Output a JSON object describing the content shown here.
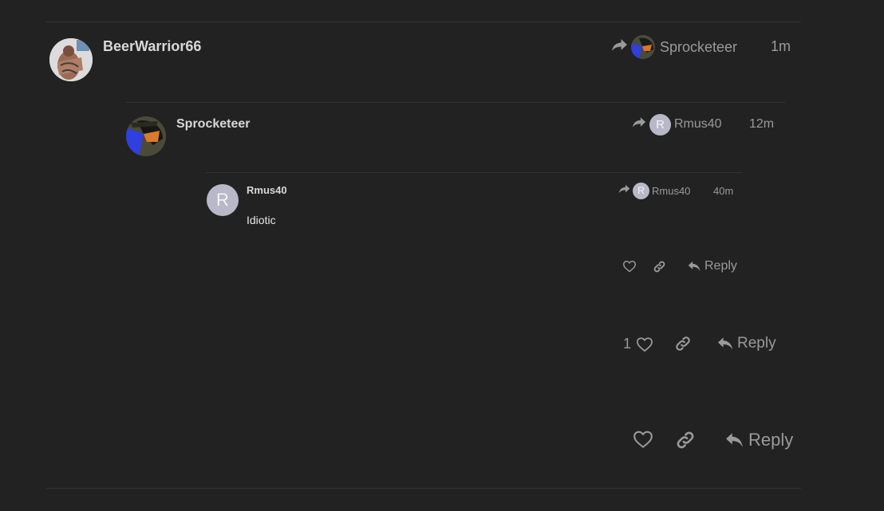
{
  "posts": [
    {
      "username": "BeerWarrior66",
      "reply_to": "Sprocketeer",
      "time": "1m",
      "actions": {
        "reply_label": "Reply"
      }
    },
    {
      "username": "Sprocketeer",
      "reply_to": "Rmus40",
      "reply_to_initial": "R",
      "time": "12m",
      "actions": {
        "like_count": "1",
        "reply_label": "Reply"
      }
    },
    {
      "username": "Rmus40",
      "avatar_initial": "R",
      "reply_to": "Rmus40",
      "reply_to_initial": "R",
      "time": "40m",
      "body": "Idiotic",
      "actions": {
        "reply_label": "Reply"
      }
    }
  ],
  "colors": {
    "background": "#222222",
    "divider": "#333333",
    "muted_text": "#9a9a9a",
    "letter_avatar": "#b8b8c8"
  },
  "icons": [
    "share-arrow-icon",
    "heart-icon",
    "link-icon",
    "reply-arrow-icon"
  ]
}
